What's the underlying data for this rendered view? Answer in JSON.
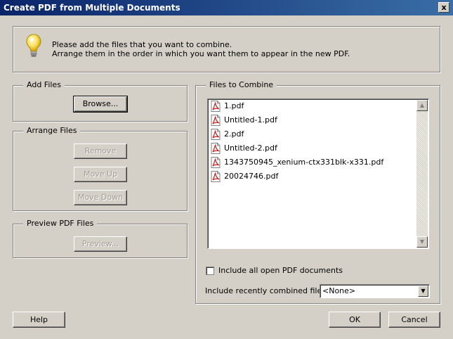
{
  "window": {
    "title": "Create PDF from Multiple Documents",
    "close_label": "x"
  },
  "info": {
    "line1": "Please add the files that you want to combine.",
    "line2": "Arrange them in the order in which you want them to appear in the new PDF.",
    "icon": "lightbulb-icon"
  },
  "add_files": {
    "title": "Add Files",
    "browse_label": "Browse..."
  },
  "arrange_files": {
    "title": "Arrange Files",
    "remove_label": "Remove",
    "move_up_label": "Move Up",
    "move_down_label": "Move Down"
  },
  "preview": {
    "title": "Preview PDF Files",
    "preview_label": "Preview..."
  },
  "files_to_combine": {
    "title": "Files to Combine",
    "files": [
      "1.pdf",
      "Untitled-1.pdf",
      "2.pdf",
      "Untitled-2.pdf",
      "1343750945_xenium-ctx331blk-x331.pdf",
      "20024746.pdf"
    ],
    "include_open_label": "Include all open PDF documents",
    "include_open_checked": false,
    "recent_label": "Include recently combined files:",
    "recent_value": "<None>"
  },
  "footer": {
    "help_label": "Help",
    "ok_label": "OK",
    "cancel_label": "Cancel"
  },
  "colors": {
    "titlebar_start": "#0a246a",
    "titlebar_end": "#3a6ea5",
    "dialog_bg": "#d4d0c8",
    "pdf_red": "#cc1f1f"
  }
}
